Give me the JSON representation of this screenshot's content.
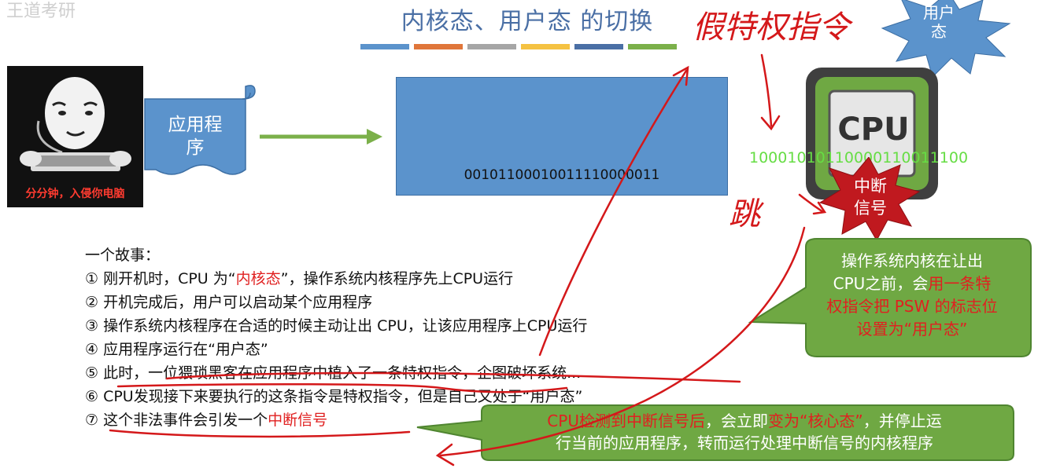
{
  "watermark": "王道考研",
  "slide": {
    "title": "内核态、用户态 的切换",
    "title_bar_colors": [
      "#5b93cc",
      "#e0763a",
      "#a6a6a6",
      "#f5c242",
      "#4a6fa5",
      "#7bb04a"
    ]
  },
  "hacker": {
    "caption": "分分钟，入侵你电脑"
  },
  "app_scroll": {
    "label_line1": "应用程",
    "label_line2": "序"
  },
  "memory_box": {
    "binary": "00101100010011110000011"
  },
  "cpu": {
    "label": "CPU",
    "binary": "10001010110000110011100"
  },
  "user_mode_star": {
    "line1": "用户",
    "line2": "态"
  },
  "interrupt_star": {
    "line1": "中断",
    "line2": "信号"
  },
  "handwriting": {
    "top": "假特权指令",
    "side": "跳"
  },
  "story": {
    "heading": "一个故事：",
    "l1_a": "① 刚开机时，CPU 为“",
    "l1_red": "内核态",
    "l1_b": "”，操作系统内核程序先上CPU运行",
    "l2": "② 开机完成后，用户可以启动某个应用程序",
    "l3": "③ 操作系统内核程序在合适的时候主动让出 CPU，让该应用程序上CPU运行",
    "l4": "④ 应用程序运行在“用户态”",
    "l5": "⑤ 此时，一位猥琐黑客在应用程序中植入了一条特权指令，企图破坏系统...",
    "l6": "⑥ CPU发现接下来要执行的这条指令是特权指令，但是自己又处于“用户态”",
    "l7_a": "⑦ 这个非法事件会引发一个",
    "l7_red": "中断信号"
  },
  "bubble_right": {
    "l1": "操作系统内核在让出",
    "l2_a": "CPU之前，会",
    "l2_red": "用一条特",
    "l3_red": "权指令把 PSW 的标志位",
    "l4_red": "设置为“用户态”"
  },
  "bubble_bottom": {
    "l1_red": "CPU检测到中断信号后",
    "l1_a": "，会立即",
    "l1_red2": "变为“核心态”",
    "l1_b": "，并停止运",
    "l2": "行当前的应用程序，转而运行处理中断信号的内核程序"
  },
  "colors": {
    "accent_blue": "#5b93cc",
    "green": "#6fa843",
    "red": "#e02020",
    "pen_red": "#d4181a"
  }
}
